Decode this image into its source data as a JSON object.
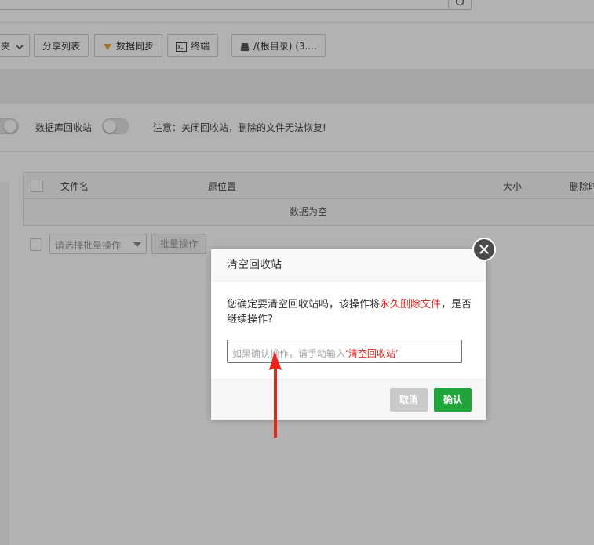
{
  "toolbar": {
    "category_label": "夹",
    "share_list_label": "分享列表",
    "data_sync_label": "数据同步",
    "terminal_label": "终端",
    "disk_label": "/(根目录) (3...."
  },
  "settings": {
    "db_recycle_label": "数据库回收站",
    "notice": "注意：关闭回收站，删除的文件无法恢复!"
  },
  "table": {
    "columns": [
      "文件名",
      "原位置",
      "大小",
      "删除时"
    ],
    "empty_text": "数据为空"
  },
  "batch": {
    "select_placeholder": "请选择批量操作",
    "button_label": "批量操作"
  },
  "dialog": {
    "title": "清空回收站",
    "message_part1": "您确定要清空回收站吗，该操作将",
    "message_red": "永久删除文件",
    "message_part2": "，是否继续操作?",
    "input_placeholder_part1": "如果确认操作，请手动输入",
    "input_placeholder_red": "‘清空回收站’",
    "cancel_label": "取消",
    "confirm_label": "确认"
  },
  "colors": {
    "confirm_green": "#20a53a",
    "warning_red": "#e0261d",
    "annotation_red": "#e8231b"
  },
  "icons": [
    "refresh-icon",
    "chevron-down-icon",
    "sync-icon",
    "terminal-icon",
    "disk-icon",
    "close-icon",
    "caret-down-icon"
  ]
}
